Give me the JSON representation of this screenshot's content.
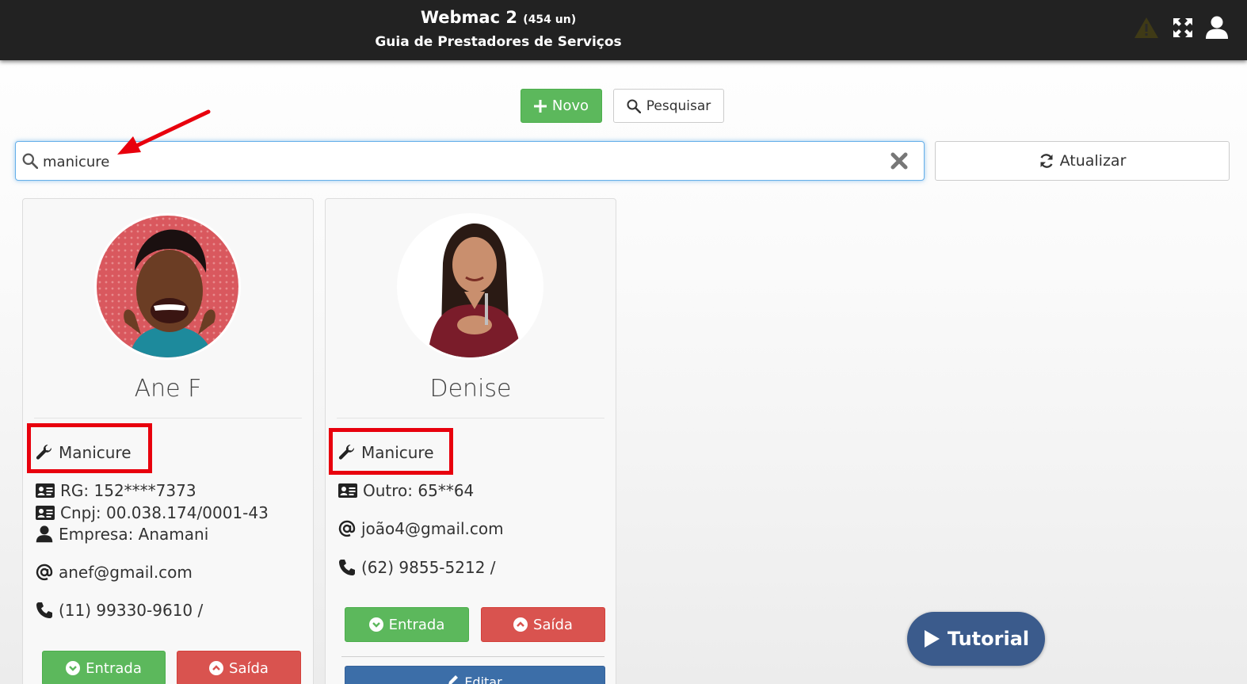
{
  "header": {
    "title": "Webmac 2",
    "count": "(454 un)",
    "subtitle": "Guia de Prestadores de Serviços",
    "icons": [
      "warning-icon",
      "fullscreen-icon",
      "user-icon"
    ]
  },
  "toolbar": {
    "novo_label": "Novo",
    "pesquisar_label": "Pesquisar",
    "atualizar_label": "Atualizar"
  },
  "search": {
    "value": "manicure"
  },
  "cards": [
    {
      "name": "Ane F",
      "service": "Manicure",
      "rg": "RG: 152****7373",
      "cnpj": "Cnpj: 00.038.174/0001-43",
      "empresa": "Empresa: Anamani",
      "email": "anef@gmail.com",
      "phone": "(11) 99330-9610 /",
      "entrada_label": "Entrada",
      "saida_label": "Saída"
    },
    {
      "name": "Denise",
      "service": "Manicure",
      "outro": "Outro: 65**64",
      "email": "joão4@gmail.com",
      "phone": "(62) 9855-5212 /",
      "entrada_label": "Entrada",
      "saida_label": "Saída",
      "editar_label": "Editar"
    }
  ],
  "tutorial": {
    "label": "Tutorial"
  },
  "colors": {
    "topbar": "#222222",
    "success": "#5cb85c",
    "danger": "#d9534f",
    "primary": "#3c6ea8",
    "highlight": "#e8000d",
    "tutorial": "#3b5b8c"
  }
}
